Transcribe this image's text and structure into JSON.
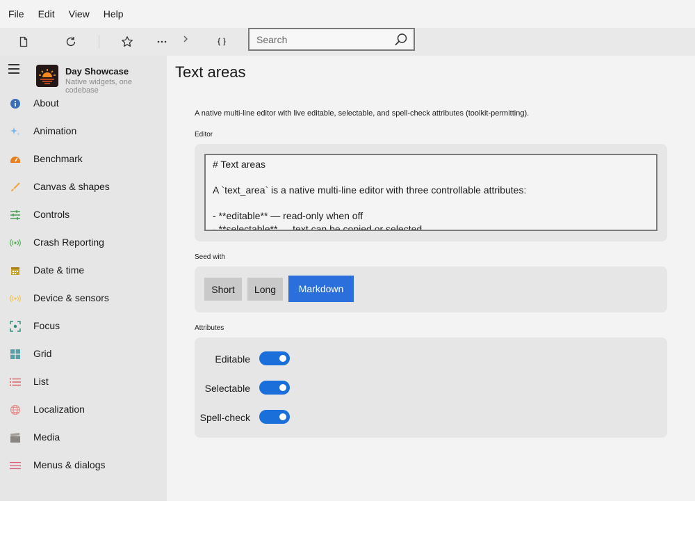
{
  "menubar": {
    "items": [
      "File",
      "Edit",
      "View",
      "Help"
    ]
  },
  "toolbar": {
    "icons": [
      "new-file-icon",
      "refresh-icon",
      "star-icon",
      "more-icon",
      "chevron-right-icon",
      "code-braces-icon"
    ],
    "search_placeholder": "Search",
    "search_value": ""
  },
  "sidebar": {
    "app_name": "Day Showcase",
    "app_subtitle": "Native widgets, one codebase",
    "items": [
      {
        "label": "About",
        "icon": "info-icon",
        "color": "#3a6fb8"
      },
      {
        "label": "Animation",
        "icon": "sparkle-icon",
        "color": "#7fb6e8"
      },
      {
        "label": "Benchmark",
        "icon": "gauge-icon",
        "color": "#e8801f"
      },
      {
        "label": "Canvas & shapes",
        "icon": "brush-icon",
        "color": "#f2a33a"
      },
      {
        "label": "Controls",
        "icon": "sliders-icon",
        "color": "#3a9a4a"
      },
      {
        "label": "Crash Reporting",
        "icon": "broadcast-icon",
        "color": "#4caf50"
      },
      {
        "label": "Date & time",
        "icon": "calendar-icon",
        "color": "#c9a227"
      },
      {
        "label": "Device & sensors",
        "icon": "sensor-icon",
        "color": "#f2c14e"
      },
      {
        "label": "Focus",
        "icon": "focus-icon",
        "color": "#2e8b7a"
      },
      {
        "label": "Grid",
        "icon": "grid-icon",
        "color": "#5aa0a8"
      },
      {
        "label": "List",
        "icon": "list-icon",
        "color": "#d94a4a"
      },
      {
        "label": "Localization",
        "icon": "globe-icon",
        "color": "#e88a8a"
      },
      {
        "label": "Media",
        "icon": "clapper-icon",
        "color": "#8a8580"
      },
      {
        "label": "Menus & dialogs",
        "icon": "menu-lines-icon",
        "color": "#e05a7a"
      }
    ]
  },
  "main": {
    "title": "Text areas",
    "description": "A native multi-line editor with live editable, selectable, and spell-check attributes (toolkit-permitting).",
    "editor_label": "Editor",
    "editor_lines": [
      "# Text areas",
      "",
      "A `text_area` is a native multi-line editor with three controllable attributes:",
      "",
      "- **editable** — read-only when off",
      "- **selectable** — text can be copied or selected"
    ],
    "seed_label": "Seed with",
    "seed_buttons": [
      "Short",
      "Long",
      "Markdown"
    ],
    "seed_selected": "Markdown",
    "attributes_label": "Attributes",
    "attributes": [
      {
        "label": "Editable",
        "on": true
      },
      {
        "label": "Selectable",
        "on": true
      },
      {
        "label": "Spell-check",
        "on": true
      }
    ]
  },
  "colors": {
    "accent": "#2a6fdb",
    "toggle_on": "#1a6fdb",
    "sidebar_bg": "#e6e6e6",
    "panel_bg": "#e6e6e6"
  }
}
